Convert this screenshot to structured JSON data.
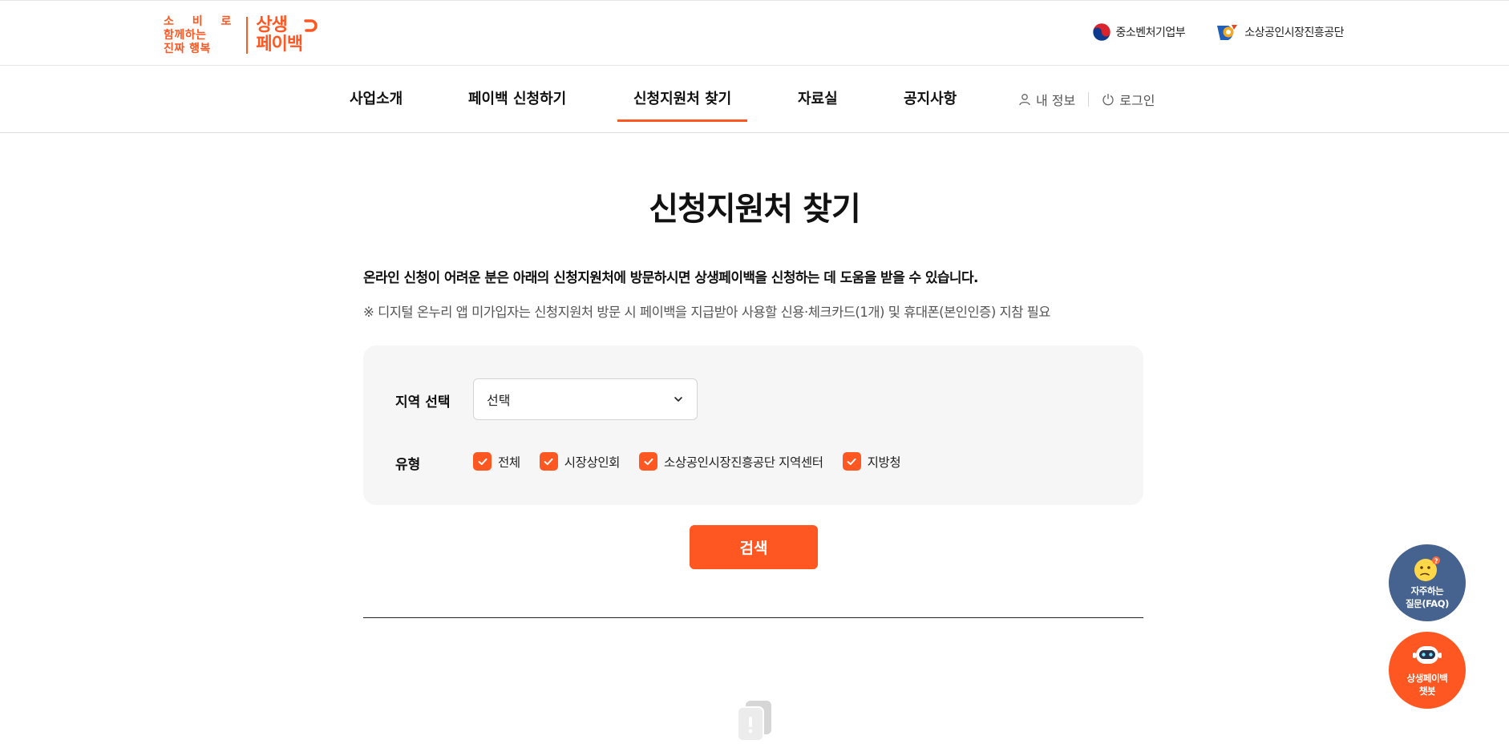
{
  "header": {
    "logo": {
      "slogan_lines": [
        "소 비 로",
        "함께하는",
        "진짜 행복"
      ],
      "brand_lines": [
        "상생",
        "페이백"
      ]
    },
    "partners": [
      {
        "name": "중소벤처기업부",
        "icon": "taegeuk-emblem-icon"
      },
      {
        "name": "소상공인시장진흥공단",
        "icon": "semas-logo-icon"
      }
    ]
  },
  "gnb": {
    "items": [
      {
        "label": "사업소개"
      },
      {
        "label": "페이백 신청하기"
      },
      {
        "label": "신청지원처 찾기",
        "active": true
      },
      {
        "label": "자료실"
      },
      {
        "label": "공지사항"
      }
    ],
    "util": {
      "my_info": "내 정보",
      "login": "로그인"
    }
  },
  "main": {
    "title": "신청지원처 찾기",
    "description": "온라인 신청이 어려운 분은 아래의 신청지원처에 방문하시면 상생페이백을 신청하는 데 도움을 받을 수 있습니다.",
    "note": "※ 디지털 온누리 앱 미가입자는 신청지원처 방문 시 페이백을 지급받아 사용할 신용·체크카드(1개) 및 휴대폰(본인인증) 지참 필요",
    "filter": {
      "region_label": "지역 선택",
      "region_value": "선택",
      "type_label": "유형",
      "types": [
        {
          "label": "전체",
          "checked": true
        },
        {
          "label": "시장상인회",
          "checked": true
        },
        {
          "label": "소상공인시장진흥공단 지역센터",
          "checked": true
        },
        {
          "label": "지방청",
          "checked": true
        }
      ]
    },
    "search_button": "검색"
  },
  "floating": {
    "faq_lines": [
      "자주하는",
      "질문(FAQ)"
    ],
    "chatbot_lines": [
      "상생페이백",
      "챗봇"
    ]
  },
  "colors": {
    "accent": "#ff5722",
    "faq_bg": "#46628f",
    "filter_bg": "#f6f6f6"
  }
}
